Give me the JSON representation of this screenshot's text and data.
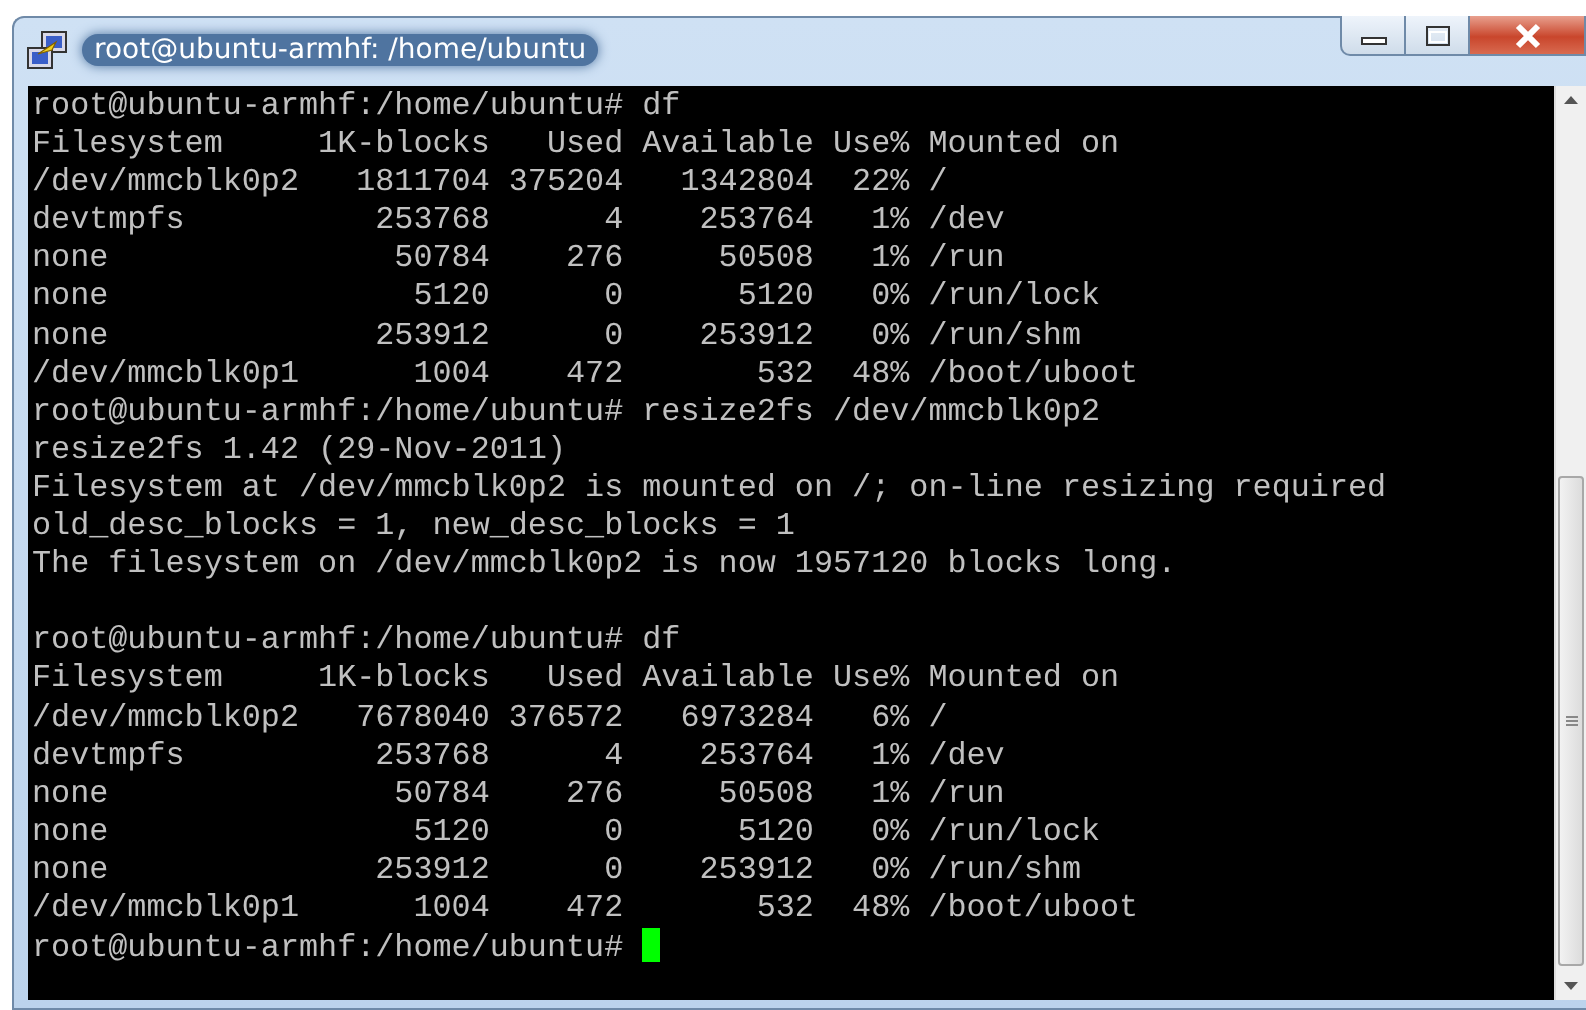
{
  "window": {
    "title": "root@ubuntu-armhf: /home/ubuntu"
  },
  "terminal": {
    "cursor": true,
    "lines": [
      {
        "kind": "text",
        "text": "root@ubuntu-armhf:/home/ubuntu# df"
      },
      {
        "kind": "text",
        "text": "Filesystem     1K-blocks   Used Available Use% Mounted on"
      },
      {
        "kind": "text",
        "text": "/dev/mmcblk0p2   1811704 375204   1342804  22% /"
      },
      {
        "kind": "text",
        "text": "devtmpfs          253768      4    253764   1% /dev"
      },
      {
        "kind": "text",
        "text": "none               50784    276     50508   1% /run"
      },
      {
        "kind": "text",
        "text": "none                5120      0      5120   0% /run/lock"
      },
      {
        "kind": "text",
        "text": "none              253912      0    253912   0% /run/shm"
      },
      {
        "kind": "text",
        "text": "/dev/mmcblk0p1      1004    472       532  48% /boot/uboot"
      },
      {
        "kind": "text",
        "text": "root@ubuntu-armhf:/home/ubuntu# resize2fs /dev/mmcblk0p2"
      },
      {
        "kind": "text",
        "text": "resize2fs 1.42 (29-Nov-2011)"
      },
      {
        "kind": "text",
        "text": "Filesystem at /dev/mmcblk0p2 is mounted on /; on-line resizing required"
      },
      {
        "kind": "text",
        "text": "old_desc_blocks = 1, new_desc_blocks = 1"
      },
      {
        "kind": "text",
        "text": "The filesystem on /dev/mmcblk0p2 is now 1957120 blocks long."
      },
      {
        "kind": "blank"
      },
      {
        "kind": "text",
        "text": "root@ubuntu-armhf:/home/ubuntu# df"
      },
      {
        "kind": "text",
        "text": "Filesystem     1K-blocks   Used Available Use% Mounted on"
      },
      {
        "kind": "text",
        "text": "/dev/mmcblk0p2   7678040 376572   6973284   6% /"
      },
      {
        "kind": "text",
        "text": "devtmpfs          253768      4    253764   1% /dev"
      },
      {
        "kind": "text",
        "text": "none               50784    276     50508   1% /run"
      },
      {
        "kind": "text",
        "text": "none                5120      0      5120   0% /run/lock"
      },
      {
        "kind": "text",
        "text": "none              253912      0    253912   0% /run/shm"
      },
      {
        "kind": "text",
        "text": "/dev/mmcblk0p1      1004    472       532  48% /boot/uboot"
      },
      {
        "kind": "text",
        "text": "root@ubuntu-armhf:/home/ubuntu# "
      }
    ]
  }
}
